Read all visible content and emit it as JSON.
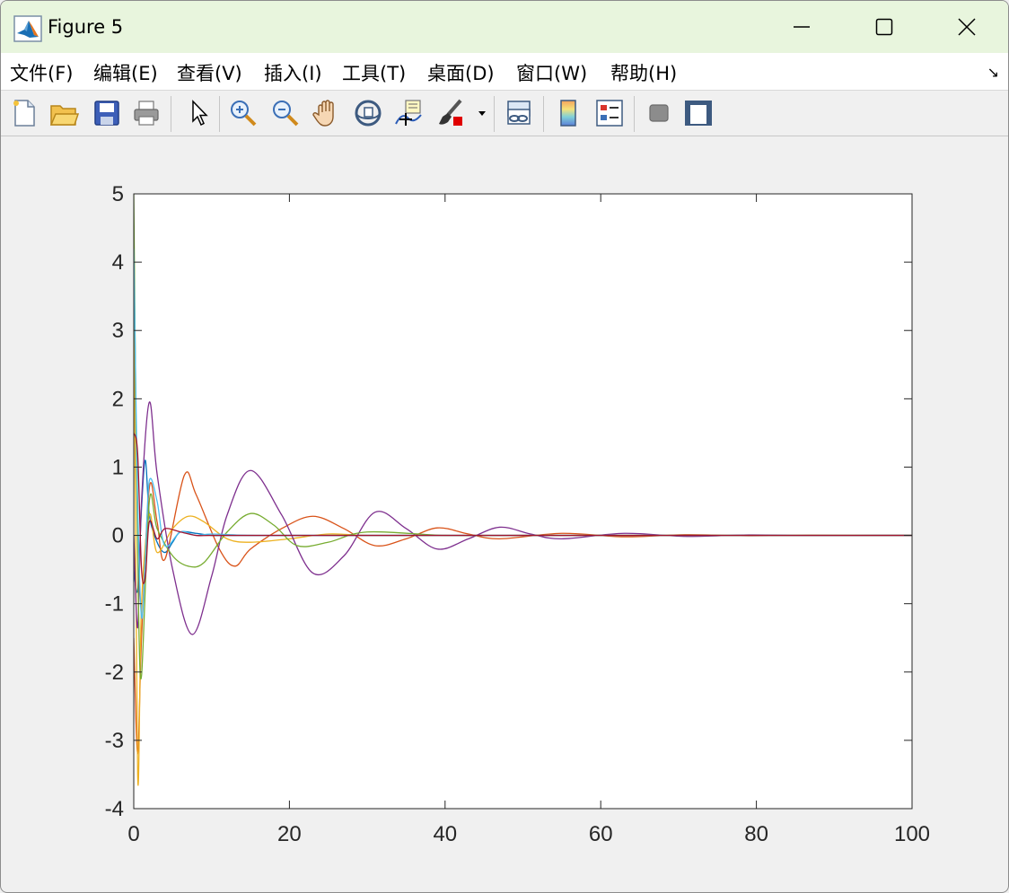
{
  "window": {
    "title": "Figure 5",
    "controls": [
      "minimize",
      "maximize",
      "close"
    ]
  },
  "menu": {
    "items": [
      {
        "label": "文件(F)"
      },
      {
        "label": "编辑(E)"
      },
      {
        "label": "查看(V)"
      },
      {
        "label": "插入(I)"
      },
      {
        "label": "工具(T)"
      },
      {
        "label": "桌面(D)"
      },
      {
        "label": "窗口(W)"
      },
      {
        "label": "帮助(H)"
      }
    ],
    "corner_icon": "↘"
  },
  "toolbar": {
    "icons": [
      "new-figure",
      "open",
      "save",
      "print",
      "edit-plot-pointer",
      "zoom-in",
      "zoom-out",
      "pan",
      "rotate-3d",
      "data-cursor",
      "brush",
      "link-plot",
      "colorbar",
      "legend",
      "hide-plot-tools",
      "show-plot-tools"
    ]
  },
  "chart_data": {
    "type": "line",
    "title": "",
    "xlabel": "",
    "ylabel": "",
    "xlim": [
      0,
      100
    ],
    "ylim": [
      -4,
      5
    ],
    "xticks": [
      0,
      20,
      40,
      60,
      80,
      100
    ],
    "yticks": [
      -4,
      -3,
      -2,
      -1,
      0,
      1,
      2,
      3,
      4,
      5
    ],
    "grid": false,
    "legend": "none",
    "colors": [
      "#0072BD",
      "#D95319",
      "#EDB120",
      "#7E2F8E",
      "#77AC30",
      "#4DBEEE",
      "#A2142F"
    ],
    "series": [
      {
        "x": [
          0,
          0.5,
          1,
          1.5,
          2,
          3,
          4,
          5,
          6,
          8,
          10,
          12,
          15,
          20,
          25,
          30,
          40,
          50,
          60,
          80,
          100
        ],
        "values": [
          -0.5,
          -0.8,
          0.4,
          1.1,
          0.3,
          -0.1,
          -0.25,
          -0.1,
          0.05,
          0.03,
          0,
          0,
          0,
          0,
          0,
          0,
          0,
          0,
          0,
          0,
          0
        ]
      },
      {
        "x": [
          0,
          0.5,
          1,
          2,
          3,
          4,
          6.5,
          8,
          11,
          13,
          15,
          19,
          23,
          27,
          31,
          35,
          39,
          43,
          47,
          55,
          63,
          71,
          79,
          87,
          95,
          100
        ],
        "values": [
          -1.5,
          -3.2,
          -1.5,
          0.7,
          0.2,
          -0.35,
          0.88,
          0.6,
          -0.2,
          -0.45,
          -0.2,
          0.1,
          0.28,
          0.1,
          -0.15,
          -0.05,
          0.11,
          0.02,
          -0.05,
          0.03,
          -0.02,
          0.01,
          -0.005,
          0.003,
          0,
          0
        ]
      },
      {
        "x": [
          0,
          0.5,
          1,
          2,
          3,
          5,
          7,
          9,
          12,
          15,
          20,
          25,
          30,
          40,
          50,
          60,
          80,
          100
        ],
        "values": [
          4,
          -3.5,
          -1,
          0.3,
          -0.25,
          0.1,
          0.28,
          0.2,
          -0.05,
          -0.1,
          -0.05,
          0.02,
          0,
          0,
          0,
          0,
          0,
          0
        ]
      },
      {
        "x": [
          0,
          0.5,
          1,
          2,
          3,
          5,
          7.5,
          10,
          12,
          15,
          19,
          23,
          27,
          31,
          35,
          39,
          43,
          47,
          51,
          55,
          63,
          71,
          79,
          87,
          95,
          100
        ],
        "values": [
          0,
          -1.35,
          0.5,
          1.95,
          0.9,
          -0.5,
          -1.45,
          -0.6,
          0.3,
          0.95,
          0.3,
          -0.55,
          -0.3,
          0.34,
          0.1,
          -0.2,
          -0.05,
          0.12,
          0.02,
          -0.05,
          0.03,
          -0.015,
          0.007,
          -0.003,
          0,
          0
        ]
      },
      {
        "x": [
          0,
          0.3,
          0.6,
          1,
          2,
          3,
          5,
          7,
          9,
          12,
          15,
          18,
          21,
          25,
          30,
          40,
          50,
          60,
          80,
          100
        ],
        "values": [
          5,
          1.5,
          -1,
          -2.05,
          0.5,
          0.1,
          -0.3,
          -0.45,
          -0.4,
          0.05,
          0.32,
          0.15,
          -0.15,
          -0.1,
          0.05,
          0,
          0,
          0,
          0,
          0
        ]
      },
      {
        "x": [
          0,
          0.5,
          1,
          1.5,
          2,
          3,
          4,
          6,
          8,
          10,
          15,
          20,
          30,
          40,
          60,
          80,
          100
        ],
        "values": [
          4.2,
          0.5,
          -1.2,
          -0.3,
          0.8,
          0.5,
          -0.15,
          0.05,
          0,
          0.02,
          0,
          0,
          0,
          0,
          0,
          0,
          0
        ]
      },
      {
        "x": [
          0,
          0.5,
          1,
          1.5,
          2,
          3,
          4,
          6,
          8,
          10,
          15,
          20,
          30,
          40,
          60,
          80,
          100
        ],
        "values": [
          1.5,
          1.2,
          -0.5,
          -0.6,
          0.2,
          -0.05,
          0.1,
          0.05,
          0,
          0,
          0,
          0,
          0,
          0,
          0,
          0,
          0
        ]
      }
    ]
  }
}
